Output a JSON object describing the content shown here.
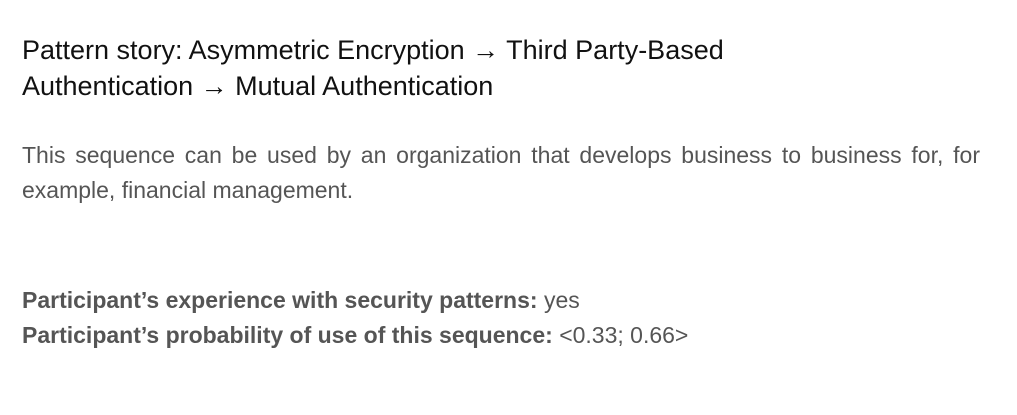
{
  "pattern_story": {
    "title": "Pattern story: Asymmetric Encryption → Third Party-Based Authentication → Mutual Authentication",
    "description": "This sequence can be used by an organization that develops business to business for, for example, financial management."
  },
  "participant": {
    "experience_label": "Participant’s experience with security patterns:",
    "experience_value": "yes",
    "probability_label": "Participant’s probability of use of this sequence:",
    "probability_value": "<0.33; 0.66>"
  },
  "colors": {
    "title_text": "#111111",
    "body_text": "#555555",
    "background": "#ffffff"
  }
}
